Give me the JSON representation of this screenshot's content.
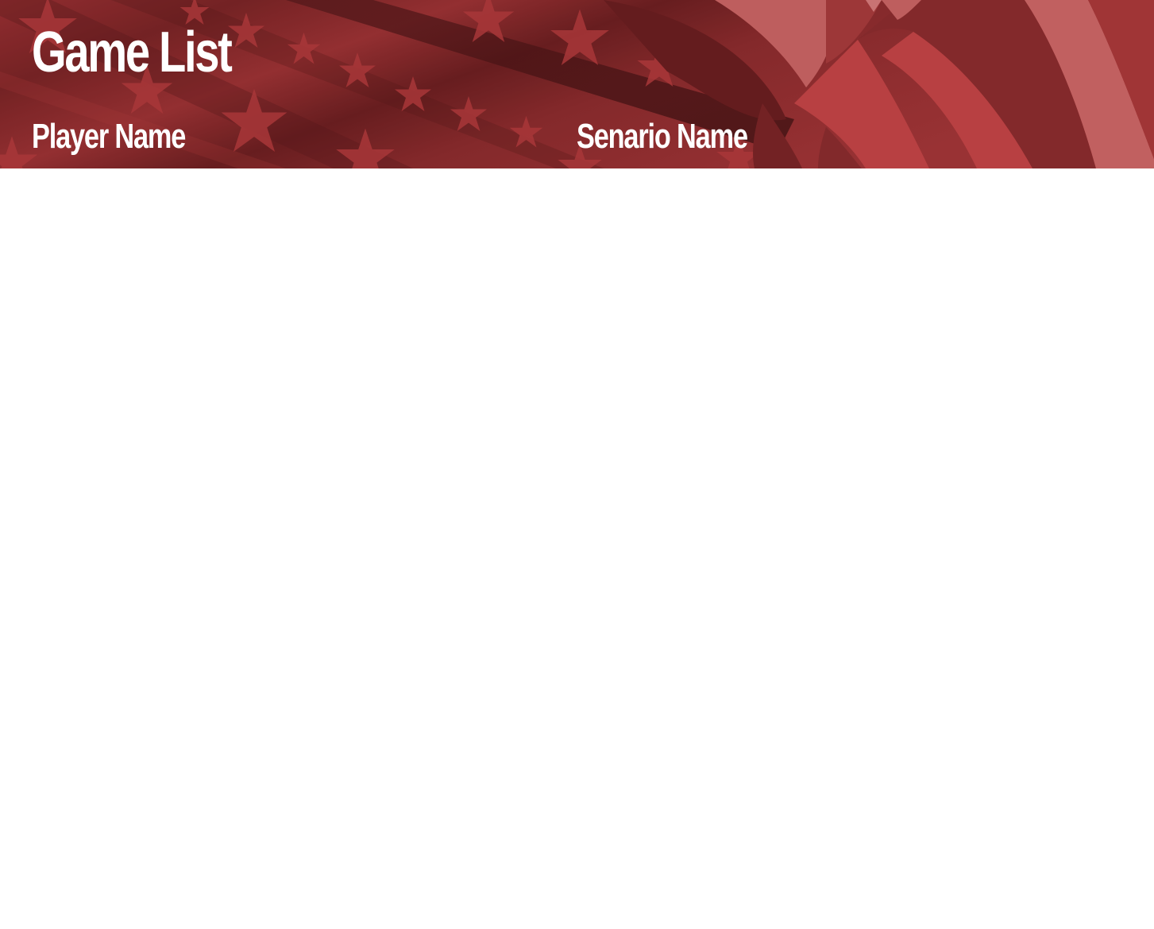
{
  "header": {
    "title": "Game List",
    "columns": {
      "player": "Player Name",
      "scenario": "Senario Name"
    }
  },
  "theme": {
    "header_base": "#8a2b2d",
    "stripe_dark": "#6e1f21",
    "stripe_light": "#c96464",
    "star_color": "#b83a3c",
    "text_color": "#ffffff"
  },
  "game_list": {
    "rows": []
  }
}
